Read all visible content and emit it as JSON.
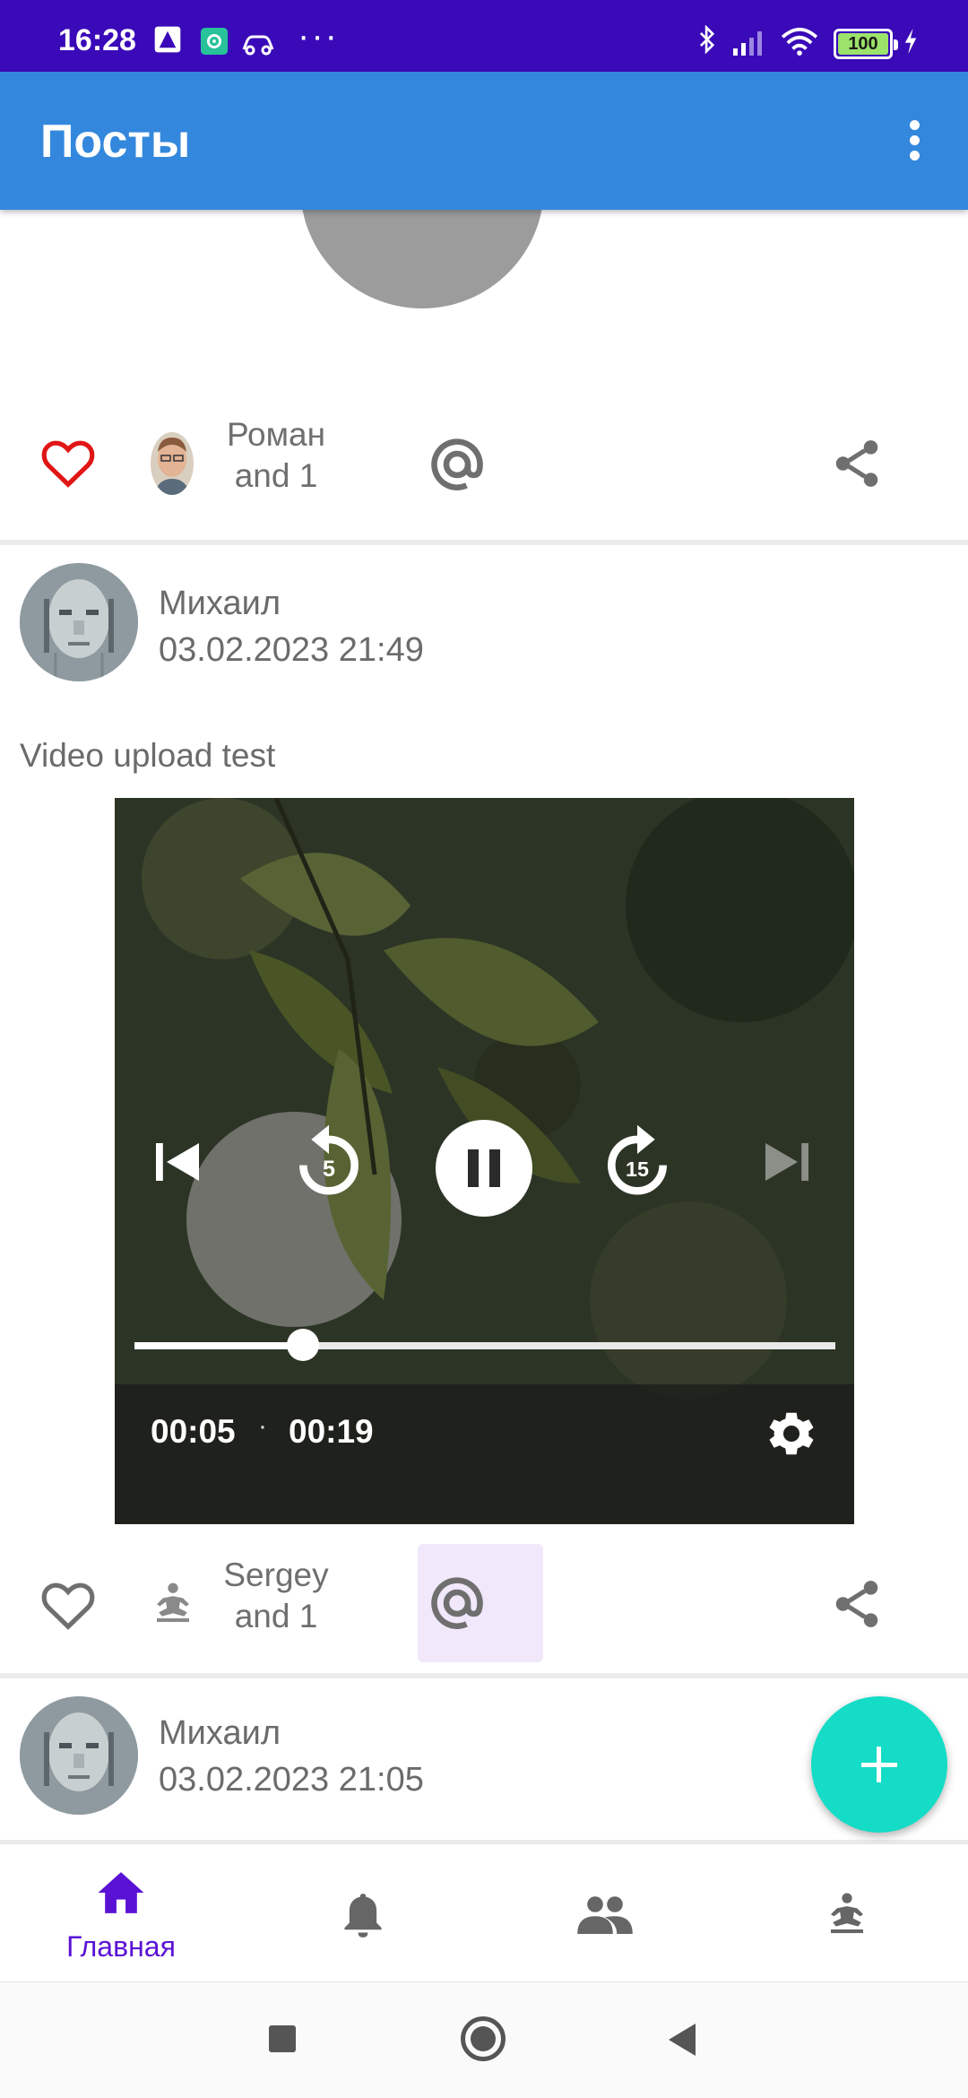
{
  "status_bar": {
    "time": "16:28",
    "battery": "100",
    "more": "···"
  },
  "app_bar": {
    "title": "Посты"
  },
  "posts": [
    {
      "likers": {
        "line1": "Роман",
        "line2": "and 1"
      },
      "liked": true
    },
    {
      "author": "Михаил",
      "date": "03.02.2023 21:49",
      "text": "Video upload test",
      "video": {
        "current_time": "00:05",
        "separator": "·",
        "duration": "00:19",
        "rewind_label": "5",
        "forward_label": "15",
        "progress": 0.24
      },
      "likers": {
        "line1": "Sergey",
        "line2": "and 1"
      },
      "liked": false
    },
    {
      "author": "Михаил",
      "date": "03.02.2023 21:05"
    }
  ],
  "bottom_nav": {
    "home_label": "Главная"
  },
  "colors": {
    "status_bar": "#3a09b8",
    "app_bar": "#3388dd",
    "accent": "#5a12d4",
    "fab": "#14dcc6",
    "like_red": "#e01616"
  }
}
